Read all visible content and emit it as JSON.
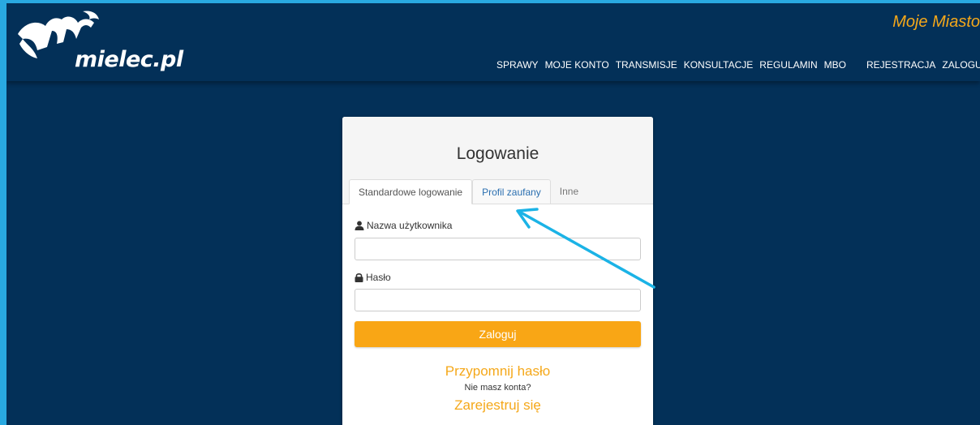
{
  "header": {
    "logo_text": "mielec.pl",
    "tagline": "Moje Miasto",
    "nav_main": [
      "SPRAWY",
      "MOJE KONTO",
      "TRANSMISJE",
      "KONSULTACJE",
      "REGULAMIN",
      "MBO"
    ],
    "nav_auth": [
      "REJESTRACJA",
      "ZALOGUJ"
    ]
  },
  "login": {
    "title": "Logowanie",
    "tabs": [
      "Standardowe logowanie",
      "Profil zaufany",
      "Inne"
    ],
    "username_label": "Nazwa użytkownika",
    "username_value": "",
    "password_label": "Hasło",
    "password_value": "",
    "submit_label": "Zaloguj",
    "remind_link": "Przypomnij hasło",
    "no_account_text": "Nie masz konta?",
    "register_link": "Zarejestruj się"
  },
  "colors": {
    "background": "#033058",
    "accent": "#f9a615",
    "border_highlight": "#29a9e1",
    "arrow": "#1bb3e6",
    "link": "#2a6fb0"
  },
  "icons": {
    "user": "user-icon",
    "lock": "lock-icon",
    "logo": "bird-logo-icon",
    "annotation": "annotation-arrow-icon"
  }
}
